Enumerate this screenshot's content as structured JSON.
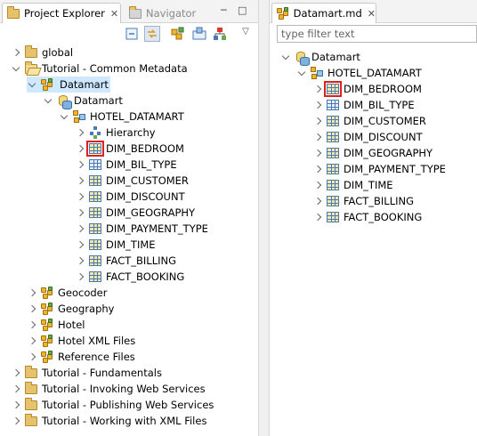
{
  "left_panel": {
    "tabs": [
      {
        "label": "Project Explorer",
        "close": "✕",
        "active": true
      },
      {
        "label": "Navigator",
        "active": false
      }
    ],
    "controls": {
      "minimize": "─",
      "maximize": "□"
    },
    "toolbar_icons": [
      "collapse-all-icon",
      "link-with-editor-icon",
      "new-project-icon",
      "import-icon",
      "model-tree-icon",
      "view-menu-icon"
    ],
    "tree": [
      {
        "label": "global",
        "icon": "folder-icon",
        "open": false
      },
      {
        "label": "Tutorial - Common Metadata",
        "icon": "folder-open-icon",
        "open": true
      },
      {
        "label": "Datamart",
        "icon": "project-icon",
        "open": true,
        "selected": true
      },
      {
        "label": "Datamart",
        "icon": "datamart-icon",
        "open": true
      },
      {
        "label": "HOTEL_DATAMART",
        "icon": "schema-icon",
        "open": true
      },
      {
        "label": "Hierarchy",
        "icon": "hierarchy-icon",
        "open": false
      },
      {
        "label": "DIM_BEDROOM",
        "icon": "dimension-table-icon",
        "open": false,
        "highlighted": true
      },
      {
        "label": "DIM_BIL_TYPE",
        "icon": "table-icon",
        "open": false
      },
      {
        "label": "DIM_CUSTOMER",
        "icon": "dimension-table-icon",
        "open": false
      },
      {
        "label": "DIM_DISCOUNT",
        "icon": "dimension-table-icon",
        "open": false
      },
      {
        "label": "DIM_GEOGRAPHY",
        "icon": "dimension-table-icon",
        "open": false
      },
      {
        "label": "DIM_PAYMENT_TYPE",
        "icon": "dimension-table-icon",
        "open": false
      },
      {
        "label": "DIM_TIME",
        "icon": "dimension-table-icon",
        "open": false
      },
      {
        "label": "FACT_BILLING",
        "icon": "dimension-table-icon",
        "open": false
      },
      {
        "label": "FACT_BOOKING",
        "icon": "dimension-table-icon",
        "open": false
      },
      {
        "label": "Geocoder",
        "icon": "project-icon",
        "open": false
      },
      {
        "label": "Geography",
        "icon": "project-icon",
        "open": false
      },
      {
        "label": "Hotel",
        "icon": "project-icon",
        "open": false
      },
      {
        "label": "Hotel XML Files",
        "icon": "project-icon",
        "open": false
      },
      {
        "label": "Reference Files",
        "icon": "project-icon",
        "open": false
      },
      {
        "label": "Tutorial - Fundamentals",
        "icon": "folder-icon",
        "open": false
      },
      {
        "label": "Tutorial - Invoking Web Services",
        "icon": "folder-icon",
        "open": false
      },
      {
        "label": "Tutorial - Publishing Web Services",
        "icon": "folder-icon",
        "open": false
      },
      {
        "label": "Tutorial - Working with XML Files",
        "icon": "folder-icon",
        "open": false
      }
    ]
  },
  "right_panel": {
    "tab": {
      "label": "Datamart.md",
      "close": "✕"
    },
    "filter": {
      "placeholder": "type filter text"
    },
    "tree": [
      {
        "label": "Datamart",
        "icon": "datamart-icon",
        "open": true
      },
      {
        "label": "HOTEL_DATAMART",
        "icon": "schema-icon",
        "open": true
      },
      {
        "label": "DIM_BEDROOM",
        "icon": "dimension-table-icon",
        "open": false,
        "highlighted": true
      },
      {
        "label": "DIM_BIL_TYPE",
        "icon": "table-icon",
        "open": false
      },
      {
        "label": "DIM_CUSTOMER",
        "icon": "dimension-table-icon",
        "open": false
      },
      {
        "label": "DIM_DISCOUNT",
        "icon": "dimension-table-icon",
        "open": false
      },
      {
        "label": "DIM_GEOGRAPHY",
        "icon": "dimension-table-icon",
        "open": false
      },
      {
        "label": "DIM_PAYMENT_TYPE",
        "icon": "dimension-table-icon",
        "open": false
      },
      {
        "label": "DIM_TIME",
        "icon": "dimension-table-icon",
        "open": false
      },
      {
        "label": "FACT_BILLING",
        "icon": "dimension-table-icon",
        "open": false
      },
      {
        "label": "FACT_BOOKING",
        "icon": "dimension-table-icon",
        "open": false
      }
    ]
  },
  "colors": {
    "selection": "#cde8ff",
    "highlight_box": "#e0201a",
    "folder": "#e8c26a"
  }
}
